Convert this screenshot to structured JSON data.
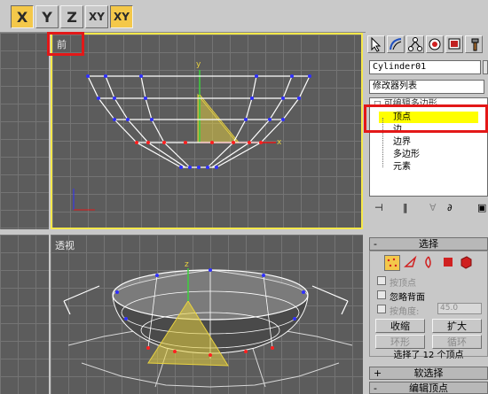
{
  "toolbar": {
    "buttons": [
      {
        "label": "X",
        "active": true
      },
      {
        "label": "Y",
        "active": false
      },
      {
        "label": "Z",
        "active": false
      },
      {
        "label": "XY",
        "active": false
      },
      {
        "label": "XY",
        "active": true
      }
    ]
  },
  "viewports": {
    "front": {
      "label": "前"
    },
    "perspective": {
      "label": "透视"
    }
  },
  "panel": {
    "object_name": "Cylinder01",
    "modifier_list_label": "修改器列表",
    "stack": {
      "root": "可编辑多边形",
      "items": [
        "顶点",
        "边",
        "边界",
        "多边形",
        "元素"
      ],
      "selected_index": 0
    },
    "selection_rollout": {
      "title": "选择",
      "by_vertex_label": "按顶点",
      "ignore_backfacing_label": "忽略背面",
      "by_angle_label": "按角度:",
      "angle_value": "45.0",
      "shrink_label": "收缩",
      "grow_label": "扩大",
      "ring_label": "环形",
      "loop_label": "循环",
      "status_text": "选择了 12 个顶点"
    },
    "soft_selection_title": "软选择",
    "edit_vertices_title": "编辑顶点"
  },
  "colors": {
    "viewport_bg": "#5c5c5c",
    "grid_line": "#747474",
    "active_border": "#f6e84a",
    "highlight_red": "#e31818",
    "selected_item": "#ffff00",
    "vertex_blue": "#3030ff",
    "vertex_red": "#ff2020",
    "gizmo_yellow": "#e8d240"
  },
  "icons": {
    "select_tool": "arrow-cursor-icon",
    "modify_tab": "curved-arrow-icon",
    "hierarchy_tab": "hierarchy-icon",
    "motion_tab": "motion-icon",
    "display_tab": "display-icon",
    "utilities_tab": "hammer-icon"
  }
}
